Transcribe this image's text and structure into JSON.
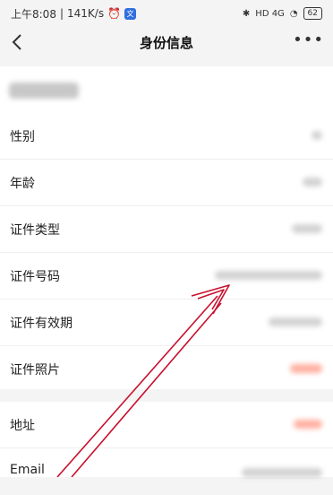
{
  "status_bar": {
    "time": "上午8:08",
    "speed": "141K/s",
    "alarm_icon": "alarm-icon",
    "app_badge": "文",
    "signal_text": "HD 4G",
    "battery": "62"
  },
  "nav": {
    "title": "身份信息",
    "back_icon": "chevron-left-icon",
    "more_icon": "more-icon",
    "more": "•••"
  },
  "rows": [
    {
      "label": "性别"
    },
    {
      "label": "年龄"
    },
    {
      "label": "证件类型"
    },
    {
      "label": "证件号码"
    },
    {
      "label": "证件有效期"
    },
    {
      "label": "证件照片"
    }
  ],
  "rows2": [
    {
      "label": "地址"
    },
    {
      "label": "Email"
    }
  ],
  "colors": {
    "background": "#f4f4f5",
    "card": "#ffffff",
    "annotation_arrow": "#c8102e",
    "highlight_value": "#ff7055"
  }
}
